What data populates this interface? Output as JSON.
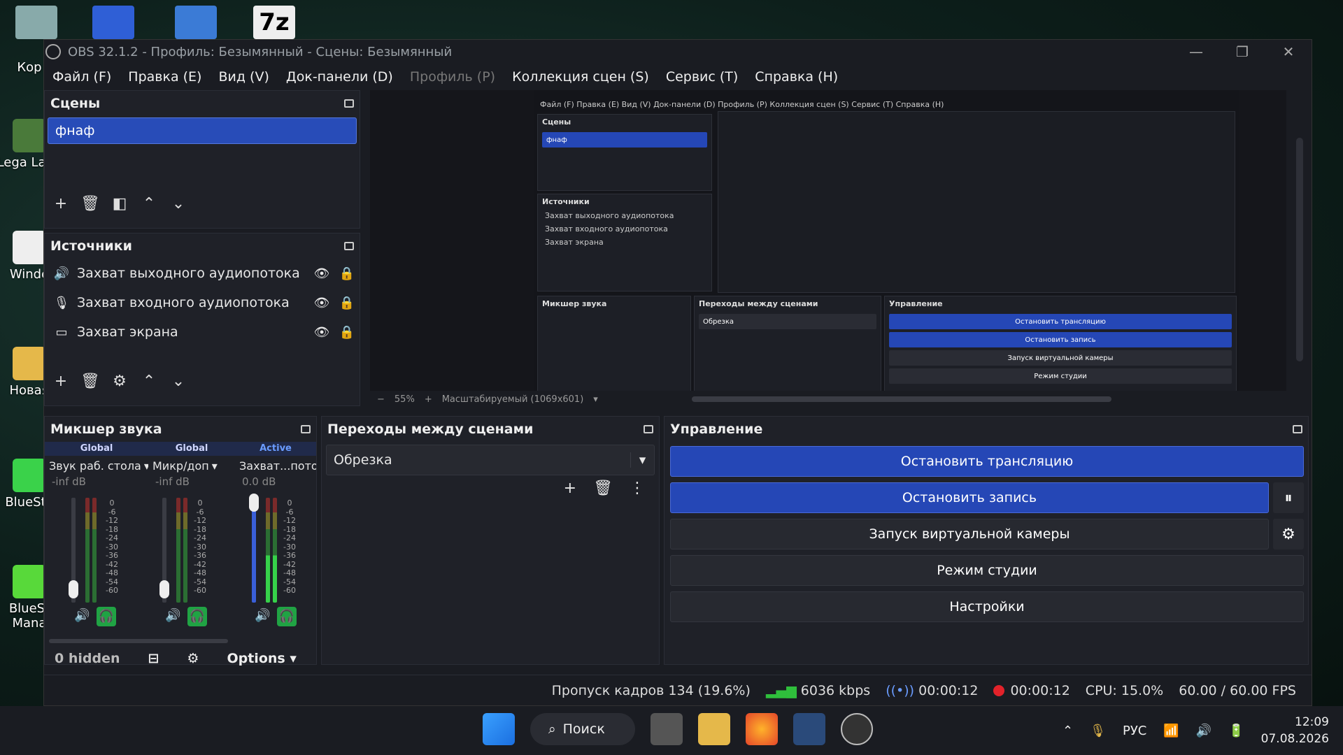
{
  "desktop": {
    "icons": [
      {
        "label": "Кор",
        "color": "#8aa"
      },
      {
        "label": "Lega Laun",
        "color": "#4a7a3a"
      },
      {
        "label": "Windo",
        "color": "#eee"
      },
      {
        "label": "Новая",
        "color": "#e5b84a"
      },
      {
        "label": "BlueSta",
        "color": "#3ad24a"
      },
      {
        "label": "BlueSt Mana",
        "color": "#58d93a"
      }
    ]
  },
  "window": {
    "title": "OBS 32.1.2 - Профиль: Безымянный - Сцены: Безымянный",
    "menu": [
      {
        "label": "Файл (F)",
        "enabled": true
      },
      {
        "label": "Правка (E)",
        "enabled": true
      },
      {
        "label": "Вид (V)",
        "enabled": true
      },
      {
        "label": "Док-панели (D)",
        "enabled": true
      },
      {
        "label": "Профиль (P)",
        "enabled": false
      },
      {
        "label": "Коллекция сцен (S)",
        "enabled": true
      },
      {
        "label": "Сервис (T)",
        "enabled": true
      },
      {
        "label": "Справка (H)",
        "enabled": true
      }
    ]
  },
  "scenes": {
    "title": "Сцены",
    "items": [
      "фнаф"
    ]
  },
  "sources": {
    "title": "Источники",
    "items": [
      {
        "name": "Захват выходного аудиопотока",
        "icon": "speaker-icon"
      },
      {
        "name": "Захват входного аудиопотока",
        "icon": "microphone-icon"
      },
      {
        "name": "Захват экрана",
        "icon": "monitor-icon"
      }
    ]
  },
  "preview": {
    "zoom": "55%",
    "mode": "Масштабируемый (1069x601)",
    "inner_menu": "Файл (F)   Правка (E)   Вид (V)   Док-панели (D)   Профиль (P)   Коллекция сцен (S)   Сервис (T)   Справка (H)",
    "inner_scenes_title": "Сцены",
    "inner_scene": "фнаф",
    "inner_sources_title": "Источники",
    "inner_sources": [
      "Захват выходного аудиопотока",
      "Захват входного аудиопотока",
      "Захват экрана"
    ],
    "inner_mixer_title": "Микшер звука",
    "inner_transitions_title": "Переходы между сценами",
    "inner_transition": "Обрезка",
    "inner_control_title": "Управление",
    "inner_buttons": [
      "Остановить трансляцию",
      "Остановить запись",
      "Запуск виртуальной камеры",
      "Режим студии"
    ]
  },
  "mixer": {
    "title": "Микшер звука",
    "channels": [
      {
        "tag": "Global",
        "name": "Звук раб. стола",
        "db": "-inf dB",
        "level": 0.0
      },
      {
        "tag": "Global",
        "name": "Микр/доп",
        "db": "-inf dB",
        "level": 0.0
      },
      {
        "tag": "Active",
        "name": "Захват...потока",
        "db": "0.0 dB",
        "level": 1.0
      }
    ],
    "scale": [
      "0",
      "-6",
      "-12",
      "-18",
      "-24",
      "-30",
      "-36",
      "-42",
      "-48",
      "-54",
      "-60"
    ],
    "hidden": "0 hidden",
    "options": "Options"
  },
  "transitions": {
    "title": "Переходы между сценами",
    "selected": "Обрезка"
  },
  "controls": {
    "title": "Управление",
    "stop_stream": "Остановить трансляцию",
    "stop_record": "Остановить запись",
    "virtual_cam": "Запуск виртуальной камеры",
    "studio_mode": "Режим студии",
    "settings": "Настройки"
  },
  "status": {
    "dropped": "Пропуск кадров 134 (19.6%)",
    "bitrate": "6036 kbps",
    "stream_time": "00:00:12",
    "record_time": "00:00:12",
    "cpu": "CPU: 15.0%",
    "fps": "60.00 / 60.00 FPS"
  },
  "taskbar": {
    "search": "Поиск",
    "lang": "РУС",
    "time": "12:09",
    "date": "07.08.2026"
  },
  "colors": {
    "accent": "#2547b6",
    "record": "#e2222a",
    "good": "#2fbf3c"
  }
}
